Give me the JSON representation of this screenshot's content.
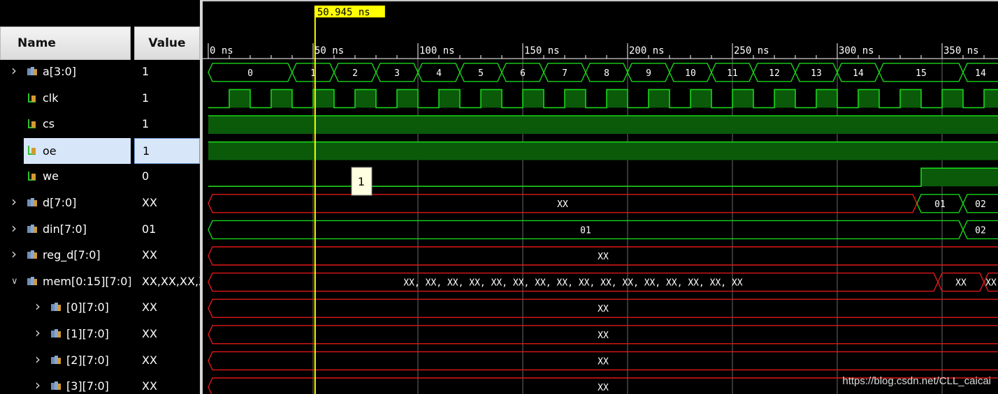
{
  "header": {
    "name_label": "Name",
    "value_label": "Value"
  },
  "cursor": {
    "time_label": "50.945 ns",
    "time_ns": 50.945
  },
  "timeline": {
    "ticks": [
      {
        "t": 0,
        "label": "0 ns"
      },
      {
        "t": 50,
        "label": "50 ns"
      },
      {
        "t": 100,
        "label": "100 ns"
      },
      {
        "t": 150,
        "label": "150 ns"
      },
      {
        "t": 200,
        "label": "200 ns"
      },
      {
        "t": 250,
        "label": "250 ns"
      },
      {
        "t": 300,
        "label": "300 ns"
      },
      {
        "t": 350,
        "label": "350 ns"
      }
    ]
  },
  "signals": [
    {
      "name": "a[3:0]",
      "value": "1",
      "type": "bus",
      "expand": "collapsed",
      "level": 0
    },
    {
      "name": "clk",
      "value": "1",
      "type": "bit",
      "level": 0
    },
    {
      "name": "cs",
      "value": "1",
      "type": "bit",
      "level": 0
    },
    {
      "name": "oe",
      "value": "1",
      "type": "bit",
      "level": 0,
      "selected": true
    },
    {
      "name": "we",
      "value": "0",
      "type": "bit",
      "level": 0
    },
    {
      "name": "d[7:0]",
      "value": "XX",
      "type": "bus",
      "expand": "collapsed",
      "level": 0
    },
    {
      "name": "din[7:0]",
      "value": "01",
      "type": "bus",
      "expand": "collapsed",
      "level": 0
    },
    {
      "name": "reg_d[7:0]",
      "value": "XX",
      "type": "bus",
      "expand": "collapsed",
      "level": 0
    },
    {
      "name": "mem[0:15][7:0]",
      "value": "XX,XX,XX,X",
      "type": "bus",
      "expand": "expanded",
      "level": 0
    },
    {
      "name": "[0][7:0]",
      "value": "XX",
      "type": "bus",
      "expand": "collapsed",
      "level": 1
    },
    {
      "name": "[1][7:0]",
      "value": "XX",
      "type": "bus",
      "expand": "collapsed",
      "level": 1
    },
    {
      "name": "[2][7:0]",
      "value": "XX",
      "type": "bus",
      "expand": "collapsed",
      "level": 1
    },
    {
      "name": "[3][7:0]",
      "value": "XX",
      "type": "bus",
      "expand": "collapsed",
      "level": 1
    }
  ],
  "waves": [
    {
      "kind": "bus",
      "color": "#19d419",
      "segments": [
        {
          "t0": 0,
          "t1": 40,
          "v": "0"
        },
        {
          "t0": 40,
          "t1": 60,
          "v": "1"
        },
        {
          "t0": 60,
          "t1": 80,
          "v": "2"
        },
        {
          "t0": 80,
          "t1": 100,
          "v": "3"
        },
        {
          "t0": 100,
          "t1": 120,
          "v": "4"
        },
        {
          "t0": 120,
          "t1": 140,
          "v": "5"
        },
        {
          "t0": 140,
          "t1": 160,
          "v": "6"
        },
        {
          "t0": 160,
          "t1": 180,
          "v": "7"
        },
        {
          "t0": 180,
          "t1": 200,
          "v": "8"
        },
        {
          "t0": 200,
          "t1": 220,
          "v": "9"
        },
        {
          "t0": 220,
          "t1": 240,
          "v": "10"
        },
        {
          "t0": 240,
          "t1": 260,
          "v": "11"
        },
        {
          "t0": 260,
          "t1": 280,
          "v": "12"
        },
        {
          "t0": 280,
          "t1": 300,
          "v": "13"
        },
        {
          "t0": 300,
          "t1": 320,
          "v": "14"
        },
        {
          "t0": 320,
          "t1": 360,
          "v": "15"
        },
        {
          "t0": 360,
          "t1": 380,
          "v": "14"
        }
      ]
    },
    {
      "kind": "clock",
      "color": "#19d419",
      "first_rise": 10,
      "period": 20,
      "high_time": 10
    },
    {
      "kind": "bit",
      "color": "#19d419",
      "levels": [
        {
          "t0": 0,
          "t1": 380,
          "v": 1
        }
      ]
    },
    {
      "kind": "bit",
      "color": "#19d419",
      "levels": [
        {
          "t0": 0,
          "t1": 380,
          "v": 1
        }
      ]
    },
    {
      "kind": "bit",
      "color": "#19d419",
      "levels": [
        {
          "t0": 0,
          "t1": 340,
          "v": 0
        },
        {
          "t0": 340,
          "t1": 380,
          "v": 1
        }
      ]
    },
    {
      "kind": "bus",
      "color": "#e01818",
      "segments": [
        {
          "t0": 0,
          "t1": 338,
          "v": "XX",
          "c": "#e01818"
        },
        {
          "t0": 338,
          "t1": 360,
          "v": "01",
          "c": "#19d419"
        },
        {
          "t0": 360,
          "t1": 380,
          "v": "02",
          "c": "#19d419"
        }
      ]
    },
    {
      "kind": "bus",
      "color": "#19d419",
      "segments": [
        {
          "t0": 0,
          "t1": 360,
          "v": "01"
        },
        {
          "t0": 360,
          "t1": 380,
          "v": "02"
        }
      ]
    },
    {
      "kind": "bus",
      "color": "#e01818",
      "segments": [
        {
          "t0": 0,
          "t1": 380,
          "v": "XX"
        }
      ]
    },
    {
      "kind": "bus",
      "color": "#e01818",
      "segments": [
        {
          "t0": 0,
          "t1": 348,
          "v": "XX, XX, XX, XX, XX, XX, XX, XX, XX, XX, XX, XX, XX, XX, XX, XX"
        },
        {
          "t0": 348,
          "t1": 370,
          "v": "XX"
        },
        {
          "t0": 370,
          "t1": 380,
          "v": "XX"
        }
      ]
    },
    {
      "kind": "bus",
      "color": "#e01818",
      "segments": [
        {
          "t0": 0,
          "t1": 380,
          "v": "XX"
        }
      ]
    },
    {
      "kind": "bus",
      "color": "#e01818",
      "segments": [
        {
          "t0": 0,
          "t1": 380,
          "v": "XX"
        }
      ]
    },
    {
      "kind": "bus",
      "color": "#e01818",
      "segments": [
        {
          "t0": 0,
          "t1": 380,
          "v": "XX"
        }
      ]
    },
    {
      "kind": "bus",
      "color": "#e01818",
      "segments": [
        {
          "t0": 0,
          "t1": 380,
          "v": "XX"
        }
      ]
    }
  ],
  "tooltip": {
    "text": "1"
  },
  "watermark": "https://blog.csdn.net/CLL_caicai",
  "colors": {
    "wave_green": "#19d419",
    "fill_green": "#0a5a0a",
    "wave_red": "#e01818",
    "cursor": "#ffff00",
    "selection": "#d8e6fa"
  }
}
